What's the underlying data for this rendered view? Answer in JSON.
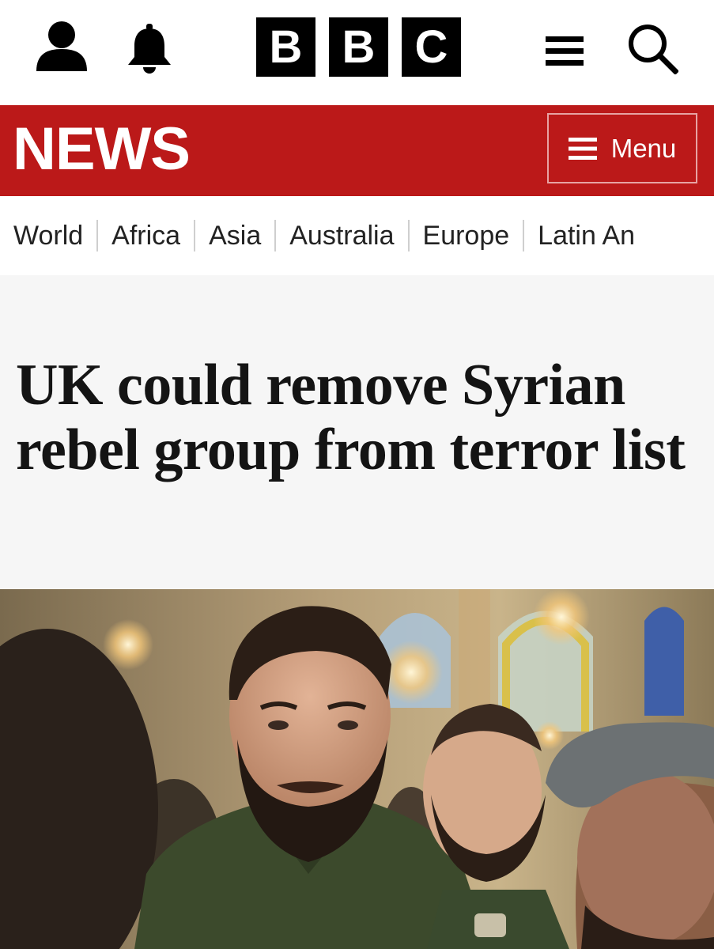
{
  "header": {
    "logo_letters": [
      "B",
      "B",
      "C"
    ],
    "icons": {
      "account": "user-icon",
      "notifications": "bell-icon",
      "more": "hamburger-menu-icon",
      "search": "search-icon"
    }
  },
  "news_band": {
    "title": "NEWS",
    "menu_label": "Menu",
    "menu_icon": "hamburger-menu-icon",
    "background_color": "#bb1919"
  },
  "nav": {
    "items": [
      "World",
      "Africa",
      "Asia",
      "Australia",
      "Europe",
      "Latin An"
    ]
  },
  "article": {
    "headline": "UK could remove Syrian rebel group from terror list"
  },
  "photo": {
    "subject": "photo-of-bearded-man-in-green-shirt-smiling-among-crowd"
  }
}
